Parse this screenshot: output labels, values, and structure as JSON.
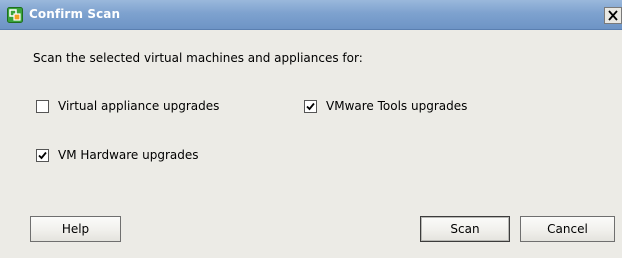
{
  "window": {
    "title": "Confirm Scan",
    "close_glyph": "X",
    "app_icon": "vsphere-logo-icon"
  },
  "dialog": {
    "prompt": "Scan the selected virtual machines and appliances for:",
    "options": [
      {
        "label": "Virtual appliance upgrades",
        "checked": false
      },
      {
        "label": "VMware Tools upgrades",
        "checked": true
      },
      {
        "label": "VM Hardware upgrades",
        "checked": true
      }
    ]
  },
  "buttons": {
    "help": "Help",
    "scan": "Scan",
    "cancel": "Cancel"
  },
  "colors": {
    "titlebar": "#7ea2cf",
    "background": "#ecebe6",
    "icon_green": "#3aa33a",
    "icon_orange": "#f0a020"
  }
}
